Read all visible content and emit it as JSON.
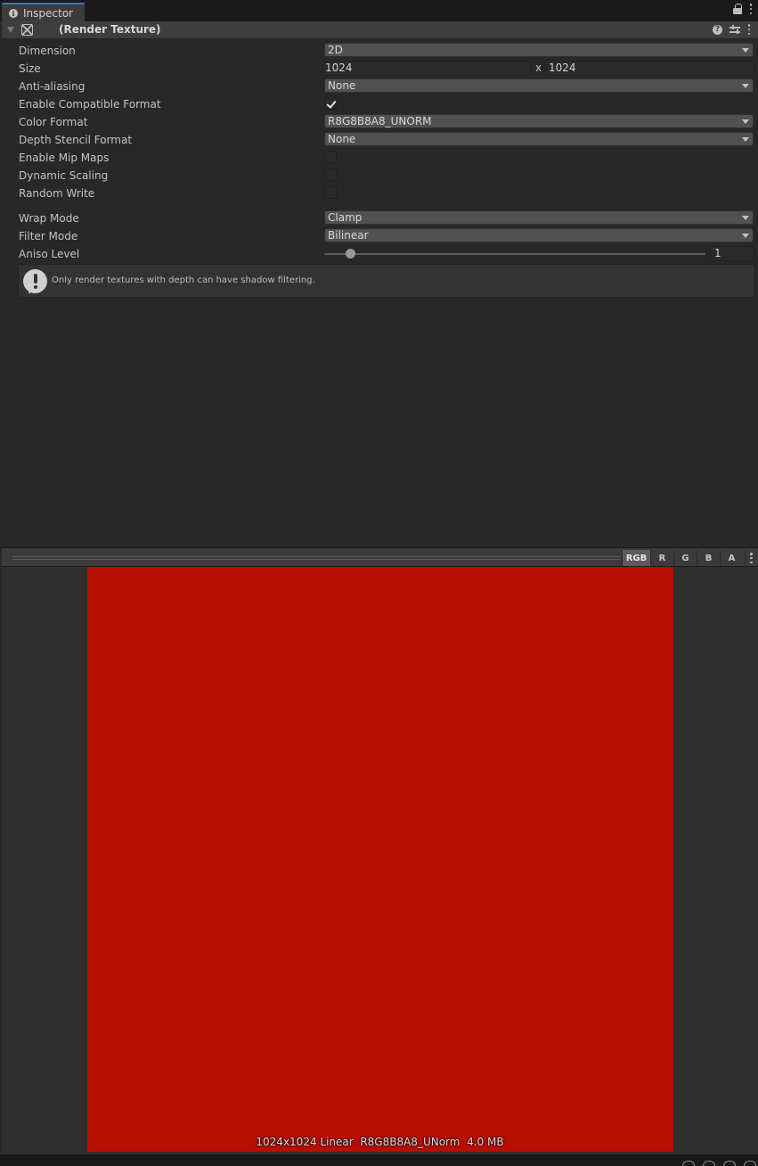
{
  "tab": {
    "label": "Inspector"
  },
  "component": {
    "title": "(Render Texture)"
  },
  "properties": {
    "dimension": {
      "label": "Dimension",
      "value": "2D"
    },
    "size": {
      "label": "Size",
      "width": "1024",
      "separator": "x",
      "height": "1024"
    },
    "anti_aliasing": {
      "label": "Anti-aliasing",
      "value": "None"
    },
    "compatible_format": {
      "label": "Enable Compatible Format",
      "checked": true
    },
    "color_format": {
      "label": "Color Format",
      "value": "R8G8B8A8_UNORM"
    },
    "depth_stencil": {
      "label": "Depth Stencil Format",
      "value": "None"
    },
    "mip_maps": {
      "label": "Enable Mip Maps",
      "checked": false
    },
    "dynamic_scaling": {
      "label": "Dynamic Scaling",
      "checked": false
    },
    "random_write": {
      "label": "Random Write",
      "checked": false
    },
    "wrap_mode": {
      "label": "Wrap Mode",
      "value": "Clamp"
    },
    "filter_mode": {
      "label": "Filter Mode",
      "value": "Bilinear"
    },
    "aniso_level": {
      "label": "Aniso Level",
      "value": "1",
      "slider_fraction": 0.07
    }
  },
  "helpbox": {
    "text": "Only render textures with depth can have shadow filtering."
  },
  "preview": {
    "channels": [
      "RGB",
      "R",
      "G",
      "B",
      "A"
    ],
    "active_channel": "RGB",
    "texture_color": "#b80d00",
    "info": "1024x1024 Linear  R8G8B8A8_UNorm  4.0 MB"
  }
}
